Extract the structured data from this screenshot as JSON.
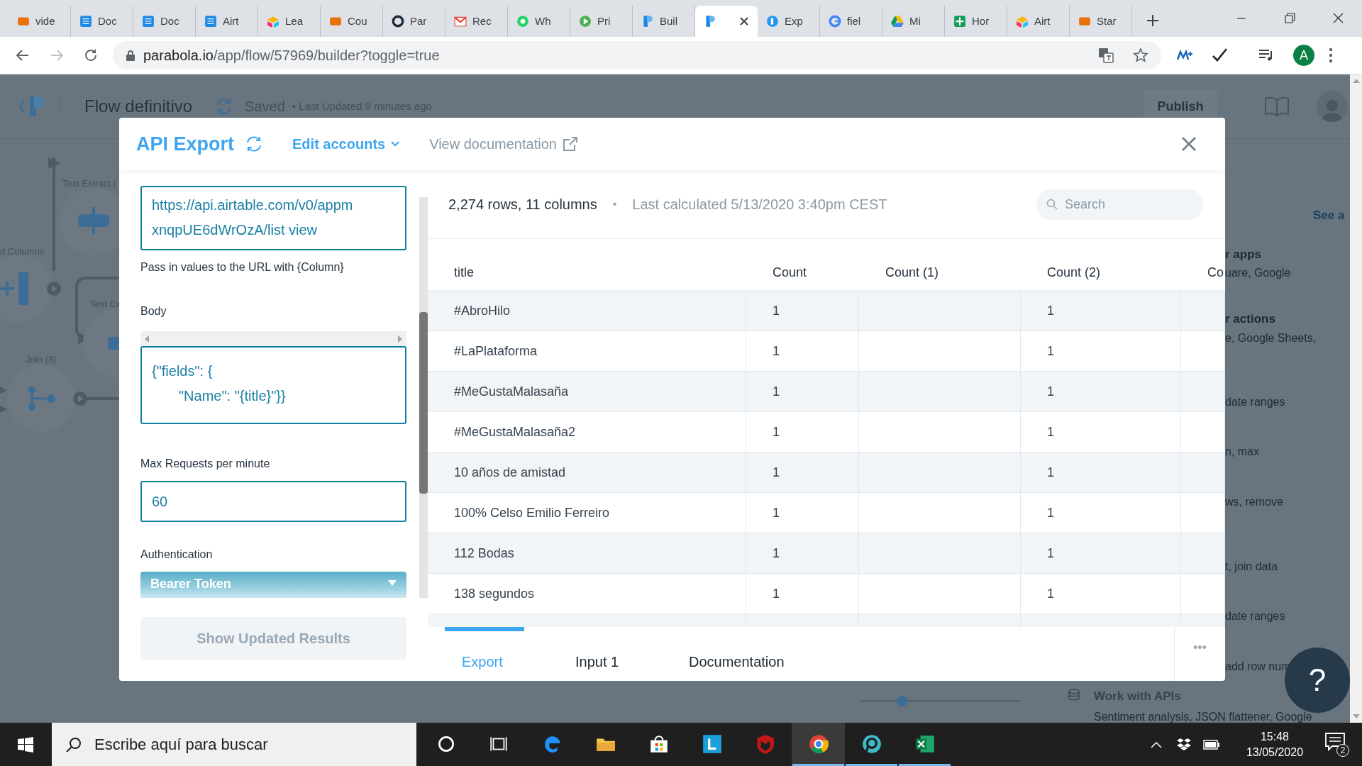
{
  "browser": {
    "tabs": [
      {
        "label": "vide",
        "selected": false
      },
      {
        "label": "Doc",
        "selected": false
      },
      {
        "label": "Doc",
        "selected": false
      },
      {
        "label": "Airt",
        "selected": false
      },
      {
        "label": "Lea",
        "selected": false
      },
      {
        "label": "Cou",
        "selected": false
      },
      {
        "label": "Par",
        "selected": false
      },
      {
        "label": "Rec",
        "selected": false
      },
      {
        "label": "Wh",
        "selected": false
      },
      {
        "label": "Pri",
        "selected": false
      },
      {
        "label": "Buil",
        "selected": false
      },
      {
        "selected": true
      },
      {
        "label": "Exp",
        "selected": false
      },
      {
        "label": "fiel",
        "selected": false
      },
      {
        "label": "Mi",
        "selected": false
      },
      {
        "label": "Hor",
        "selected": false
      },
      {
        "label": "Airt",
        "selected": false
      },
      {
        "label": "Star",
        "selected": false
      }
    ],
    "url_host": "parabola.io",
    "url_path": "/app/flow/57969/builder?toggle=true",
    "profile": "A"
  },
  "app": {
    "title": "Flow definitivo",
    "status": "Saved",
    "last_updated": "• Last Updated 9 minutes ago",
    "publish": "Publish"
  },
  "canvas": {
    "nodes": [
      {
        "label": "Text Extract ("
      },
      {
        "label": "d Columns"
      },
      {
        "label": "Text Ex"
      },
      {
        "label": "Join (3)"
      }
    ]
  },
  "side_panel": {
    "see_all": "See a",
    "lines": [
      {
        "text": "r apps",
        "kind": "heading"
      },
      {
        "text": "uare, Google",
        "kind": "desc"
      },
      {
        "text": "r actions",
        "kind": "heading"
      },
      {
        "text": "e, Google Sheets,",
        "kind": "desc"
      },
      {
        "text": "date ranges",
        "kind": "desc"
      },
      {
        "text": "n, max",
        "kind": "desc"
      },
      {
        "text": "ws, remove",
        "kind": "desc"
      },
      {
        "text": "t, join data",
        "kind": "desc"
      },
      {
        "text": "date ranges",
        "kind": "desc"
      },
      {
        "text": "add row num",
        "kind": "desc"
      }
    ],
    "section": {
      "title": "Work with APIs",
      "desc": "Sentiment analysis, JSON flattener, Google"
    },
    "zoom_slider": {
      "level": 0.26
    },
    "help": "?"
  },
  "modal": {
    "title": "API Export",
    "edit_accounts": "Edit accounts",
    "view_documentation": "View documentation",
    "settings": {
      "url_lines": [
        "https://api.airtable.com/v0/appm",
        "xnqpUE6dWrOzA/list view"
      ],
      "url_hint": "Pass in values to the URL with {Column}",
      "body_label": "Body",
      "body_lines": [
        "{\"fields\": {",
        "\"Name\": \"{title}\"}}"
      ],
      "rate_label": "Max Requests per minute",
      "rate_value": "60",
      "auth_label": "Authentication",
      "auth_value": "Bearer Token",
      "show_button": "Show Updated Results"
    },
    "summary": "2,274 rows, 11 columns",
    "separator": "•",
    "last_calculated": "Last calculated 5/13/2020 3:40pm CEST",
    "search": {
      "placeholder": "Search"
    },
    "table": {
      "columns": [
        "title",
        "Count",
        "Count (1)",
        "Count (2)",
        "Co"
      ],
      "rows": [
        {
          "cells": [
            "#AbroHilo",
            "1",
            null,
            "1"
          ]
        },
        {
          "cells": [
            "#LaPlataforma",
            "1",
            null,
            "1"
          ]
        },
        {
          "cells": [
            "#MeGustaMalasaña",
            "1",
            null,
            "1"
          ]
        },
        {
          "cells": [
            "#MeGustaMalasaña2",
            "1",
            null,
            "1"
          ]
        },
        {
          "cells": [
            "10 años de amistad",
            "1",
            null,
            "1"
          ]
        },
        {
          "cells": [
            "100% Celso Emilio Ferreiro",
            "1",
            null,
            "1"
          ]
        },
        {
          "cells": [
            "112 Bodas",
            "1",
            null,
            "1"
          ]
        },
        {
          "cells": [
            "138 segundos",
            "1",
            null,
            "1"
          ]
        }
      ]
    },
    "tabs": [
      {
        "label": "Export",
        "selected": true
      },
      {
        "label": "Input 1",
        "selected": false
      },
      {
        "label": "Documentation",
        "selected": false
      }
    ],
    "more": "•••"
  },
  "taskbar": {
    "search": {
      "placeholder": "Escribe aquí para buscar"
    },
    "apps": [
      {
        "running": false,
        "selected": false
      },
      {
        "running": false,
        "selected": false
      },
      {
        "running": false,
        "selected": false
      },
      {
        "running": false,
        "selected": false
      },
      {
        "running": false,
        "selected": false
      },
      {
        "running": false,
        "selected": false
      },
      {
        "running": false,
        "selected": false
      },
      {
        "running": true,
        "selected": true
      },
      {
        "running": true,
        "selected": false
      },
      {
        "running": true,
        "selected": false
      }
    ],
    "time": "15:48",
    "date": "13/05/2020",
    "notifications": "2"
  }
}
